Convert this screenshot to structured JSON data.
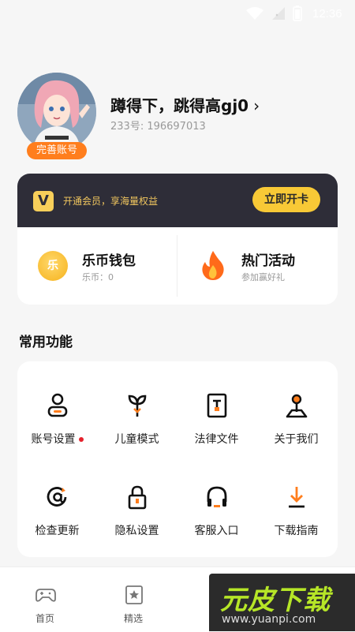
{
  "status_bar": {
    "time": "12:36"
  },
  "profile": {
    "username": "蹲得下，跳得高gj0",
    "chevron": "›",
    "uid": "233号: 196697013",
    "complete_badge": "完善账号"
  },
  "vip": {
    "logo_letter": "V",
    "text": "开通会员，享海量权益",
    "button": "立即开卡"
  },
  "wallet": {
    "coin_icon_text": "乐",
    "title": "乐币钱包",
    "subtitle": "乐币：0",
    "hot_title": "热门活动",
    "hot_subtitle": "参加赢好礼"
  },
  "section_title": "常用功能",
  "functions": [
    {
      "label": "账号设置",
      "icon": "account-icon",
      "badge": true
    },
    {
      "label": "儿童模式",
      "icon": "sprout-icon"
    },
    {
      "label": "法律文件",
      "icon": "document-icon"
    },
    {
      "label": "关于我们",
      "icon": "map-pin-icon"
    },
    {
      "label": "检查更新",
      "icon": "at-refresh-icon"
    },
    {
      "label": "隐私设置",
      "icon": "lock-icon"
    },
    {
      "label": "客服入口",
      "icon": "headphones-icon"
    },
    {
      "label": "下载指南",
      "icon": "download-icon"
    }
  ],
  "bottom_nav": [
    {
      "label": "首页",
      "icon": "gamepad-icon"
    },
    {
      "label": "精选",
      "icon": "star-bookmark-icon"
    }
  ],
  "watermark": {
    "main": "元皮下载",
    "url": "www.yuanpi.com"
  },
  "colors": {
    "accent": "#ff7e1d",
    "vip_bg": "#2e2d38",
    "vip_gold": "#f8c936"
  }
}
